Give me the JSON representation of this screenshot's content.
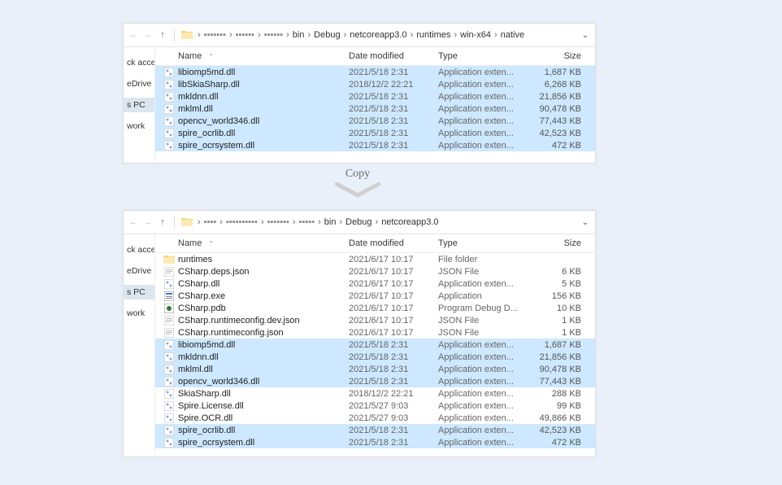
{
  "top": {
    "breadcrumb": [
      "bin",
      "Debug",
      "netcoreapp3.0",
      "runtimes",
      "win-x64",
      "native"
    ],
    "sidebar": [
      "ck access",
      "eDrive",
      "s PC",
      "work"
    ],
    "cols": {
      "name": "Name",
      "date": "Date modified",
      "type": "Type",
      "size": "Size"
    },
    "rows": [
      {
        "sel": true,
        "icon": "dll",
        "name": "libiomp5md.dll",
        "date": "2021/5/18 2:31",
        "type": "Application exten...",
        "size": "1,687 KB"
      },
      {
        "sel": true,
        "icon": "dll",
        "name": "libSkiaSharp.dll",
        "date": "2018/12/2 22:21",
        "type": "Application exten...",
        "size": "6,268 KB"
      },
      {
        "sel": true,
        "icon": "dll",
        "name": "mkldnn.dll",
        "date": "2021/5/18 2:31",
        "type": "Application exten...",
        "size": "21,856 KB"
      },
      {
        "sel": true,
        "icon": "dll",
        "name": "mklml.dll",
        "date": "2021/5/18 2:31",
        "type": "Application exten...",
        "size": "90,478 KB"
      },
      {
        "sel": true,
        "icon": "dll",
        "name": "opencv_world346.dll",
        "date": "2021/5/18 2:31",
        "type": "Application exten...",
        "size": "77,443 KB"
      },
      {
        "sel": true,
        "icon": "dll",
        "name": "spire_ocrlib.dll",
        "date": "2021/5/18 2:31",
        "type": "Application exten...",
        "size": "42,523 KB"
      },
      {
        "sel": true,
        "icon": "dll",
        "name": "spire_ocrsystem.dll",
        "date": "2021/5/18 2:31",
        "type": "Application exten...",
        "size": "472 KB"
      }
    ]
  },
  "copy_label": "Copy",
  "bottom": {
    "breadcrumb": [
      "bin",
      "Debug",
      "netcoreapp3.0"
    ],
    "sidebar": [
      "ck access",
      "eDrive",
      "s PC",
      "work"
    ],
    "cols": {
      "name": "Name",
      "date": "Date modified",
      "type": "Type",
      "size": "Size"
    },
    "rows": [
      {
        "sel": false,
        "icon": "folder",
        "name": "runtimes",
        "date": "2021/6/17 10:17",
        "type": "File folder",
        "size": ""
      },
      {
        "sel": false,
        "icon": "json",
        "name": "CSharp.deps.json",
        "date": "2021/6/17 10:17",
        "type": "JSON File",
        "size": "6 KB"
      },
      {
        "sel": false,
        "icon": "dll",
        "name": "CSharp.dll",
        "date": "2021/6/17 10:17",
        "type": "Application exten...",
        "size": "5 KB"
      },
      {
        "sel": false,
        "icon": "exe",
        "name": "CSharp.exe",
        "date": "2021/6/17 10:17",
        "type": "Application",
        "size": "156 KB"
      },
      {
        "sel": false,
        "icon": "pdb",
        "name": "CSharp.pdb",
        "date": "2021/6/17 10:17",
        "type": "Program Debug D...",
        "size": "10 KB"
      },
      {
        "sel": false,
        "icon": "json",
        "name": "CSharp.runtimeconfig.dev.json",
        "date": "2021/6/17 10:17",
        "type": "JSON File",
        "size": "1 KB"
      },
      {
        "sel": false,
        "icon": "json",
        "name": "CSharp.runtimeconfig.json",
        "date": "2021/6/17 10:17",
        "type": "JSON File",
        "size": "1 KB"
      },
      {
        "sel": true,
        "icon": "dll",
        "name": "libiomp5md.dll",
        "date": "2021/5/18 2:31",
        "type": "Application exten...",
        "size": "1,687 KB"
      },
      {
        "sel": true,
        "icon": "dll",
        "name": "mkldnn.dll",
        "date": "2021/5/18 2:31",
        "type": "Application exten...",
        "size": "21,856 KB"
      },
      {
        "sel": true,
        "icon": "dll",
        "name": "mklml.dll",
        "date": "2021/5/18 2:31",
        "type": "Application exten...",
        "size": "90,478 KB"
      },
      {
        "sel": true,
        "icon": "dll",
        "name": "opencv_world346.dll",
        "date": "2021/5/18 2:31",
        "type": "Application exten...",
        "size": "77,443 KB"
      },
      {
        "sel": false,
        "icon": "dll",
        "name": "SkiaSharp.dll",
        "date": "2018/12/2 22:21",
        "type": "Application exten...",
        "size": "288 KB"
      },
      {
        "sel": false,
        "icon": "dll",
        "name": "Spire.License.dll",
        "date": "2021/5/27 9:03",
        "type": "Application exten...",
        "size": "99 KB"
      },
      {
        "sel": false,
        "icon": "dll",
        "name": "Spire.OCR.dll",
        "date": "2021/5/27 9:03",
        "type": "Application exten...",
        "size": "49,866 KB"
      },
      {
        "sel": true,
        "icon": "dll",
        "name": "spire_ocrlib.dll",
        "date": "2021/5/18 2:31",
        "type": "Application exten...",
        "size": "42,523 KB"
      },
      {
        "sel": true,
        "icon": "dll",
        "name": "spire_ocrsystem.dll",
        "date": "2021/5/18 2:31",
        "type": "Application exten...",
        "size": "472 KB"
      }
    ]
  }
}
